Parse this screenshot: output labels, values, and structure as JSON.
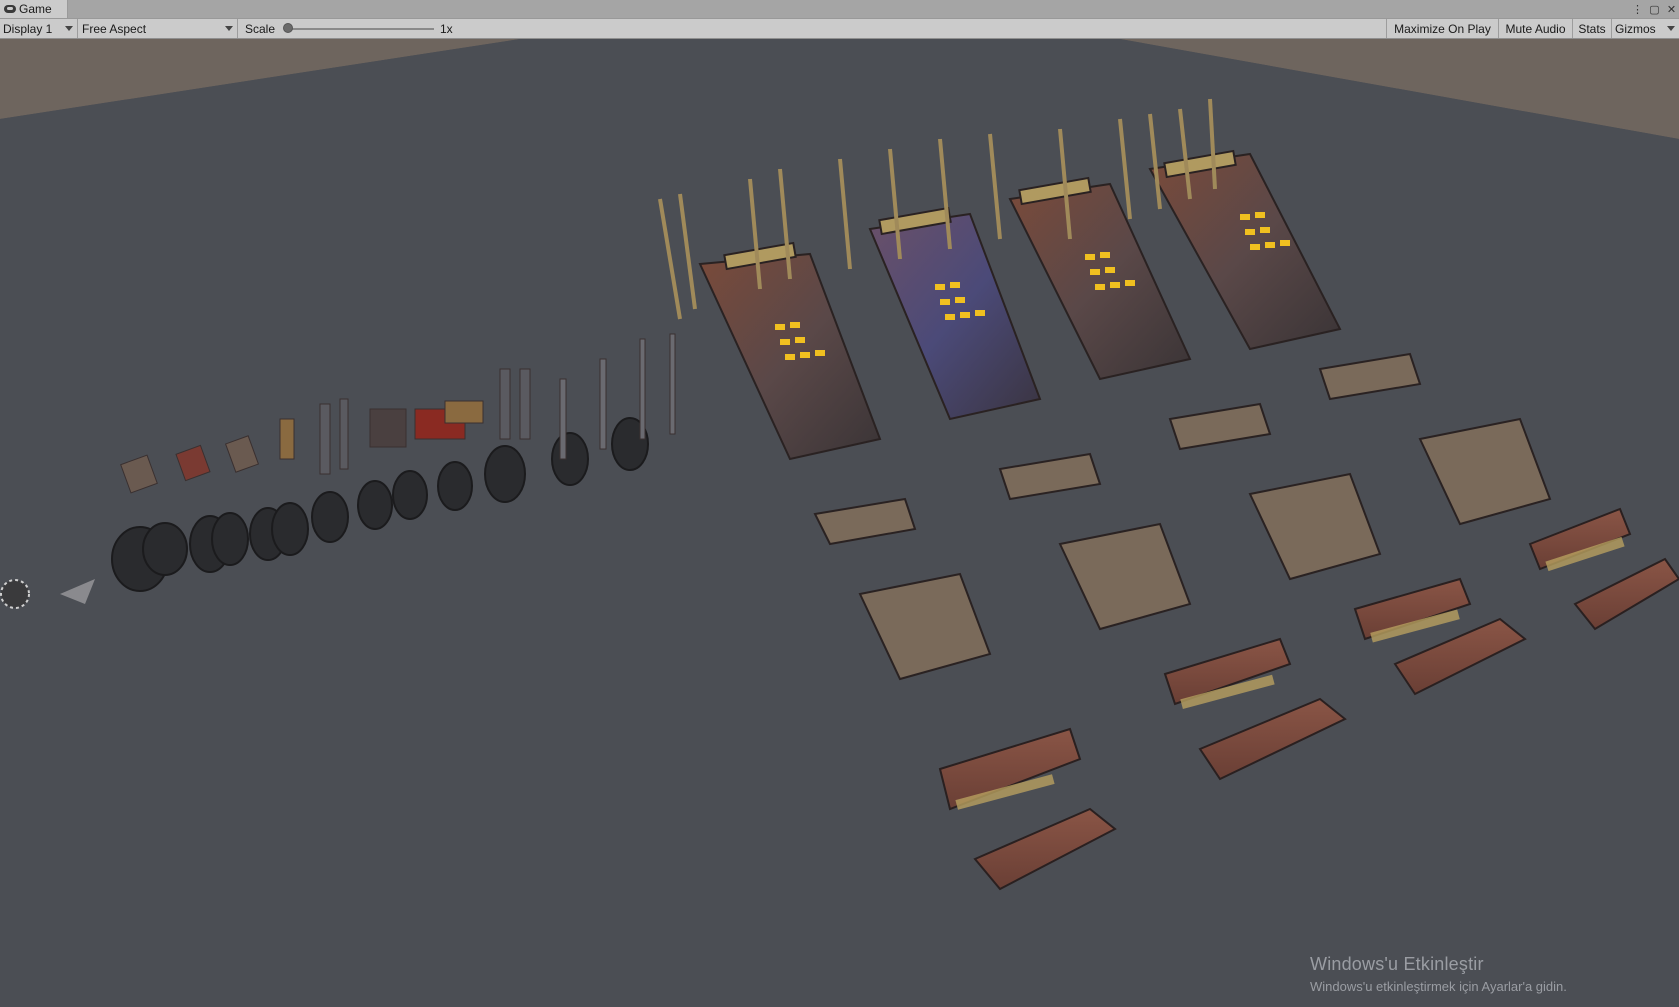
{
  "tab": {
    "title": "Game",
    "icon": "gamepad-icon"
  },
  "window_controls": [
    "kebab-menu-icon",
    "maximize-icon",
    "close-icon"
  ],
  "toolbar": {
    "display": "Display 1",
    "aspect": "Free Aspect",
    "scale_label": "Scale",
    "scale_value": "1x",
    "scale_slider_fraction": 0.0,
    "maximize_on_play": "Maximize On Play",
    "mute_audio": "Mute Audio",
    "stats": "Stats",
    "gizmos": "Gizmos"
  },
  "viewport": {
    "background_color": "#4b4e54",
    "backdrop_color": "#6e655e",
    "scene_content": [
      "vehicle",
      "vehicle",
      "vehicle",
      "vehicle",
      "wheels",
      "weapons",
      "bumpers",
      "ramps"
    ]
  },
  "watermark": {
    "title": "Windows'u Etkinleştir",
    "subtitle": "Windows'u etkinleştirmek için Ayarlar'a gidin."
  }
}
